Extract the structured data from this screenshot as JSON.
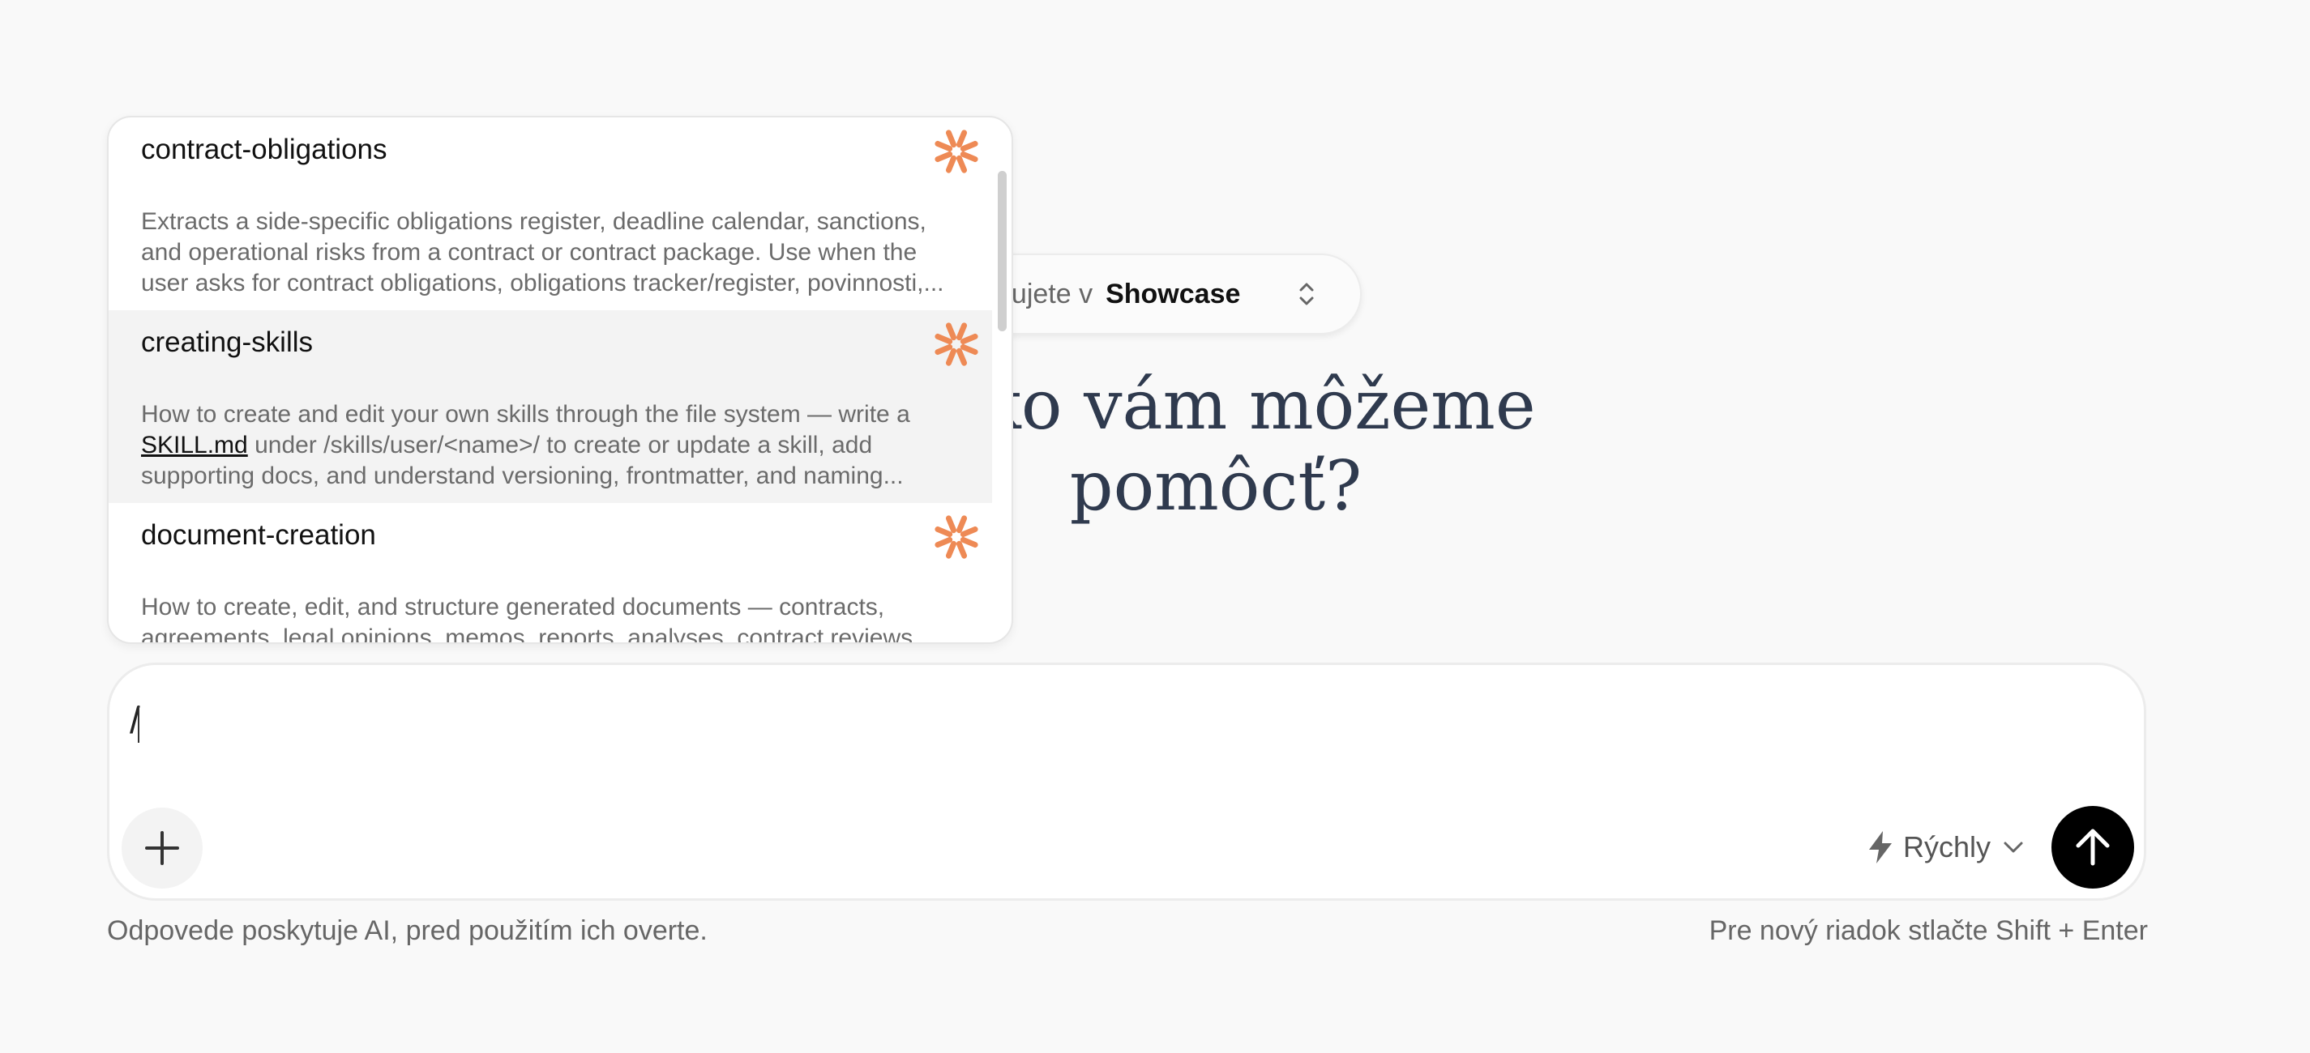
{
  "workspace": {
    "prefix": "acujete v",
    "name": "Showcase"
  },
  "headline": {
    "line1": ", ako vám môžeme",
    "line2": "pomôcť?"
  },
  "skills_menu": {
    "items": [
      {
        "name": "contract-obligations",
        "desc_lines": [
          "Extracts a side-specific obligations register, deadline calendar, sanctions,",
          "and operational risks from a contract or contract package. Use when the",
          "user asks for contract obligations, obligations tracker/register, povinnosti,..."
        ],
        "icon": "asterisk-logo-icon"
      },
      {
        "name": "creating-skills",
        "desc_line1": "How to create and edit your own skills through the file system — write a",
        "desc_link": "SKILL.md",
        "desc_line2_rest": " under /skills/user/<name>/ to create or update a skill, add",
        "desc_line3": "supporting docs, and understand versioning, frontmatter, and naming...",
        "icon": "asterisk-logo-icon"
      },
      {
        "name": "document-creation",
        "desc_lines": [
          "How to create, edit, and structure generated documents — contracts,",
          "agreements, legal opinions, memos, reports, analyses, contract reviews,"
        ],
        "icon": "asterisk-logo-icon"
      }
    ]
  },
  "composer": {
    "value": "/",
    "model_label": "Rýchly",
    "add_icon": "plus-icon",
    "send_icon": "arrow-up-icon",
    "model_icon": "lightning-icon"
  },
  "footer": {
    "disclaimer": "Odpovede poskytuje AI, pred použitím ich overte.",
    "hint": "Pre nový riadok stlačte Shift + Enter"
  },
  "colors": {
    "accent": "#ee8a55",
    "headline": "#2f3a4e",
    "send": "#000000"
  }
}
